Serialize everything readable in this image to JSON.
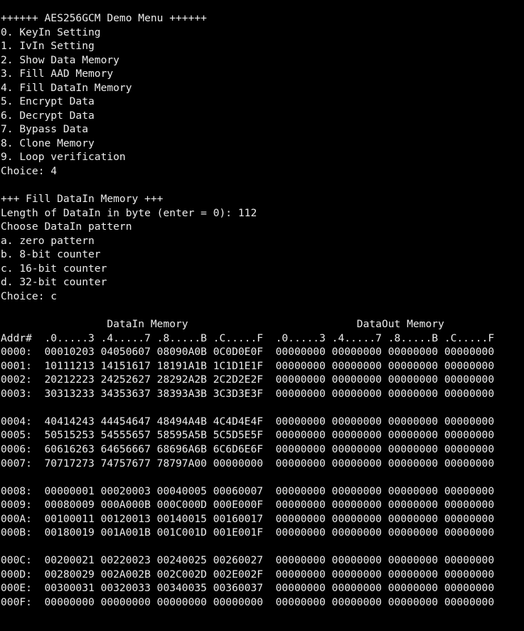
{
  "menu": {
    "title": "++++++ AES256GCM Demo Menu ++++++",
    "items": [
      "0. KeyIn Setting",
      "1. IvIn Setting",
      "2. Show Data Memory",
      "3. Fill AAD Memory",
      "4. Fill DataIn Memory",
      "5. Encrypt Data",
      "6. Decrypt Data",
      "7. Bypass Data",
      "8. Clone Memory",
      "9. Loop verification"
    ],
    "choice": "Choice: 4"
  },
  "fill": {
    "title": "+++ Fill DataIn Memory +++",
    "length_prompt": "Length of DataIn in byte (enter = 0): 112",
    "pattern_prompt": "Choose DataIn pattern",
    "options": [
      "a. zero pattern",
      "b. 8-bit counter",
      "c. 16-bit counter",
      "d. 32-bit counter"
    ],
    "choice": "Choice: c"
  },
  "memory": {
    "header_titles": "                 DataIn Memory                           DataOut Memory",
    "header_columns": "Addr#  .0.....3 .4.....7 .8.....B .C.....F  .0.....3 .4.....7 .8.....B .C.....F",
    "groups": [
      [
        "0000:  00010203 04050607 08090A0B 0C0D0E0F  00000000 00000000 00000000 00000000",
        "0001:  10111213 14151617 18191A1B 1C1D1E1F  00000000 00000000 00000000 00000000",
        "0002:  20212223 24252627 28292A2B 2C2D2E2F  00000000 00000000 00000000 00000000",
        "0003:  30313233 34353637 38393A3B 3C3D3E3F  00000000 00000000 00000000 00000000"
      ],
      [
        "0004:  40414243 44454647 48494A4B 4C4D4E4F  00000000 00000000 00000000 00000000",
        "0005:  50515253 54555657 58595A5B 5C5D5E5F  00000000 00000000 00000000 00000000",
        "0006:  60616263 64656667 68696A6B 6C6D6E6F  00000000 00000000 00000000 00000000",
        "0007:  70717273 74757677 78797A00 00000000  00000000 00000000 00000000 00000000"
      ],
      [
        "0008:  00000001 00020003 00040005 00060007  00000000 00000000 00000000 00000000",
        "0009:  00080009 000A000B 000C000D 000E000F  00000000 00000000 00000000 00000000",
        "000A:  00100011 00120013 00140015 00160017  00000000 00000000 00000000 00000000",
        "000B:  00180019 001A001B 001C001D 001E001F  00000000 00000000 00000000 00000000"
      ],
      [
        "000C:  00200021 00220023 00240025 00260027  00000000 00000000 00000000 00000000",
        "000D:  00280029 002A002B 002C002D 002E002F  00000000 00000000 00000000 00000000",
        "000E:  00300031 00320033 00340035 00360037  00000000 00000000 00000000 00000000",
        "000F:  00000000 00000000 00000000 00000000  00000000 00000000 00000000 00000000"
      ]
    ]
  },
  "colors": {
    "background": "#000000",
    "text": "#ECECEC"
  }
}
